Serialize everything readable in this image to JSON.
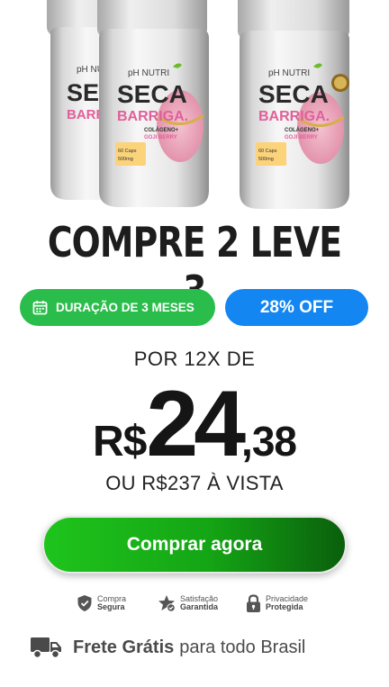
{
  "product": {
    "brand": "pH NUTRI",
    "name_line1": "SECA",
    "name_line2": "BARRIGA.",
    "subtitle_line1": "COLÁGENO+",
    "subtitle_line2": "GOJI BERRY",
    "caps_line1": "60 Caps",
    "caps_line2": "500mg"
  },
  "offer": {
    "headline": "COMPRE 2 LEVE 3",
    "duration_badge": "DURAÇÃO DE 3 MESES",
    "discount_badge": "28% OFF"
  },
  "pricing": {
    "installments_label": "POR 12X DE",
    "currency": "R$",
    "integer": "24",
    "decimal": ",38",
    "cash_price": "OU R$237 À VISTA"
  },
  "cta": {
    "label": "Comprar agora"
  },
  "trust": [
    {
      "line1": "Compra",
      "line2": "Segura",
      "icon": "shield-check-icon"
    },
    {
      "line1": "Satisfação",
      "line2": "Garantida",
      "icon": "star-check-icon"
    },
    {
      "line1": "Privacidade",
      "line2": "Protegida",
      "icon": "lock-icon"
    }
  ],
  "shipping": {
    "bold": "Frete Grátis",
    "rest": "para todo Brasil"
  },
  "colors": {
    "green": "#2bbd4b",
    "blue": "#1386f2",
    "button_start": "#1fc41c",
    "button_end": "#0a5f0c",
    "brand_green": "#6dbb2c",
    "brand_pink": "#e0609a"
  }
}
